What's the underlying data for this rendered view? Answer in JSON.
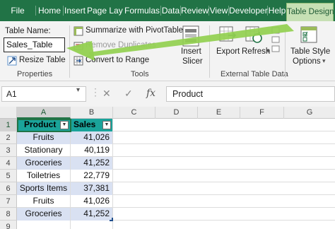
{
  "tabs": [
    {
      "label": "File"
    },
    {
      "label": "Home"
    },
    {
      "label": "Insert"
    },
    {
      "label": "Page Layout"
    },
    {
      "label": "Formulas"
    },
    {
      "label": "Data"
    },
    {
      "label": "Review"
    },
    {
      "label": "View"
    },
    {
      "label": "Developer"
    },
    {
      "label": "Help"
    },
    {
      "label": "Table Design"
    }
  ],
  "ribbon": {
    "properties": {
      "table_name_label": "Table Name:",
      "table_name_value": "Sales_Table",
      "resize_table": "Resize Table",
      "group_label": "Properties"
    },
    "tools": {
      "summarize": "Summarize with PivotTable",
      "remove_duplicates": "Remove Duplicates",
      "convert_to_range": "Convert to Range",
      "insert_slicer_line1": "Insert",
      "insert_slicer_line2": "Slicer",
      "group_label": "Tools"
    },
    "external": {
      "export": "Export",
      "refresh": "Refresh",
      "group_label": "External Table Data"
    },
    "styles": {
      "table_style_line1": "Table Style",
      "table_style_line2": "Options"
    }
  },
  "formula_bar": {
    "cell_ref": "A1",
    "cancel_glyph": "✕",
    "enter_glyph": "✓",
    "fx_glyph": "fx",
    "value": "Product"
  },
  "grid": {
    "columns": [
      "A",
      "B",
      "C",
      "D",
      "E",
      "F",
      "G"
    ],
    "rows": [
      "1",
      "2",
      "3",
      "4",
      "5",
      "6",
      "7",
      "8",
      "9"
    ],
    "header": [
      "Product",
      "Sales"
    ],
    "data": [
      [
        "Fruits",
        "41,026"
      ],
      [
        "Stationary",
        "40,119"
      ],
      [
        "Groceries",
        "41,252"
      ],
      [
        "Toiletries",
        "22,779"
      ],
      [
        "Sports Items",
        "37,381"
      ],
      [
        "Fruits",
        "41,026"
      ],
      [
        "Groceries",
        "41,252"
      ]
    ]
  },
  "colors": {
    "ribbon_green": "#217346",
    "active_tab": "#c6e0b4",
    "table_header": "#1aa39a",
    "table_band": "#d9e1f2",
    "arrow": "#92d050"
  }
}
